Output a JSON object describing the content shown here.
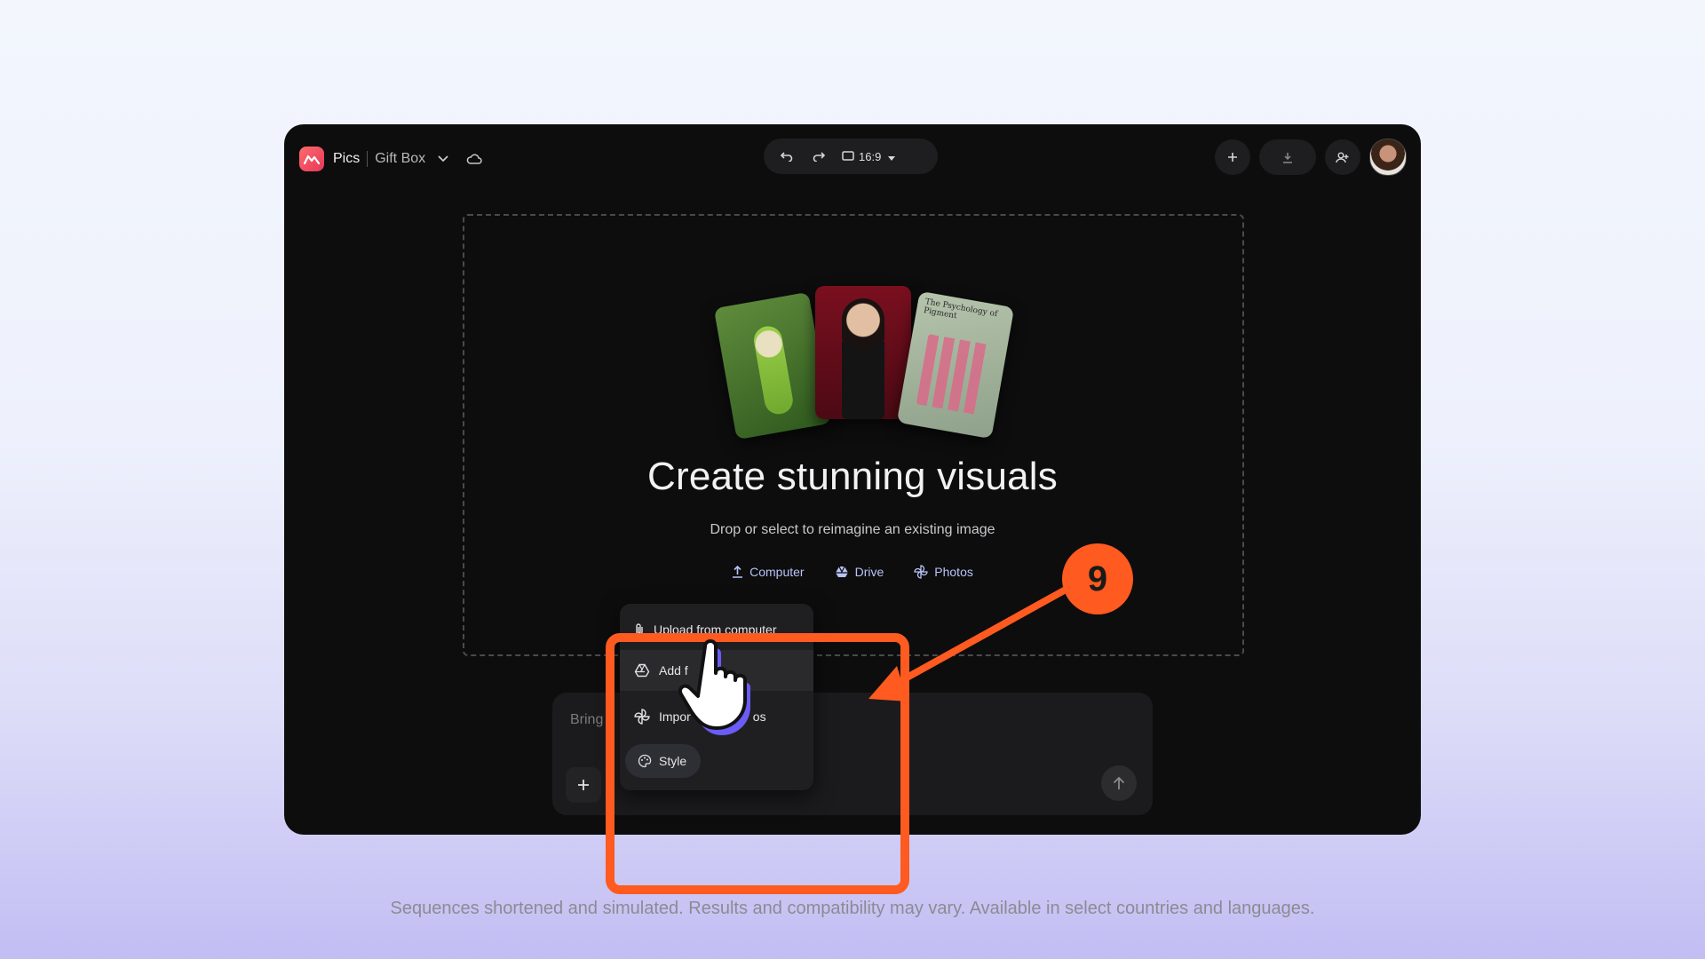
{
  "header": {
    "app_name": "Pics",
    "project_name": "Gift Box",
    "aspect_ratio": "16:9"
  },
  "preview_cards": {
    "card3_title": "The Psychology of Pigment"
  },
  "hero": {
    "title": "Create stunning visuals",
    "subtitle": "Drop or select to reimagine an existing image",
    "sources": [
      {
        "label": "Computer",
        "icon": "upload-icon"
      },
      {
        "label": "Drive",
        "icon": "drive-icon"
      },
      {
        "label": "Photos",
        "icon": "photos-icon"
      }
    ]
  },
  "prompt": {
    "placeholder": "Bring"
  },
  "menu": {
    "items": [
      {
        "label": "Upload from computer",
        "icon": "paperclip-icon"
      },
      {
        "label": "Add f",
        "icon": "drive-icon"
      },
      {
        "label": "Impor",
        "label_tail": "os",
        "icon": "photos-icon"
      }
    ],
    "style_chip": "Style"
  },
  "annotation": {
    "step_number": "9",
    "color": "#ff5a1f"
  },
  "footer": {
    "disclaimer": "Sequences shortened and simulated. Results and compatibility may vary. Available in select countries and languages."
  },
  "colors": {
    "app_background": "#0d0d0e",
    "accent_link": "#b8c3f7",
    "logo": "#e6375a"
  }
}
